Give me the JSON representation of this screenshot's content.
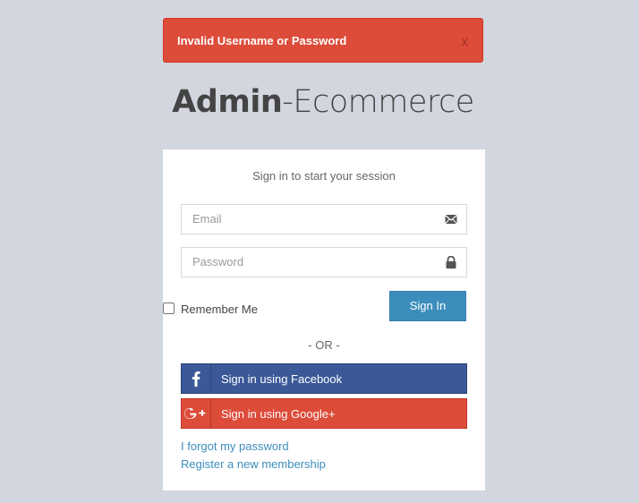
{
  "alert": {
    "message": "Invalid Username or Password",
    "close_label": "x"
  },
  "logo": {
    "bold": "Admin",
    "light": "-Ecommerce"
  },
  "login": {
    "message": "Sign in to start your session",
    "email_placeholder": "Email",
    "email_icon": "envelope-icon",
    "password_placeholder": "Password",
    "password_icon": "lock-icon",
    "remember_label": "Remember Me",
    "remember_checked": false,
    "signin_label": "Sign In",
    "or_label": "- OR -",
    "facebook_label": "Sign in using Facebook",
    "google_label": "Sign in using Google+",
    "forgot_label": "I forgot my password",
    "register_label": "Register a new membership"
  },
  "colors": {
    "background": "#d2d6de",
    "alert": "#dd4b39",
    "primary": "#3c8dbc",
    "facebook": "#3b5998",
    "google": "#dd4b39"
  }
}
